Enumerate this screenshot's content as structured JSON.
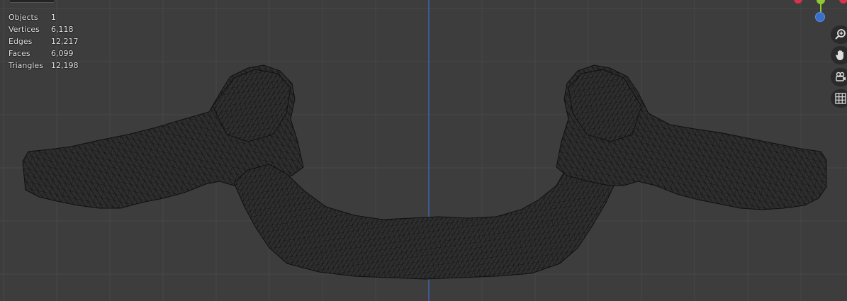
{
  "stats": [
    {
      "label": "Objects",
      "value": "1"
    },
    {
      "label": "Vertices",
      "value": "6,118"
    },
    {
      "label": "Edges",
      "value": "12,217"
    },
    {
      "label": "Faces",
      "value": "6,099"
    },
    {
      "label": "Triangles",
      "value": "12,198"
    }
  ],
  "navigation": {
    "buttons": [
      {
        "name": "zoom",
        "icon": "zoom-icon"
      },
      {
        "name": "pan",
        "icon": "hand-icon"
      },
      {
        "name": "camera-view",
        "icon": "camera-icon"
      },
      {
        "name": "toggle-ortho",
        "icon": "grid-icon"
      }
    ]
  },
  "colors": {
    "background": "#3d3d3d",
    "grid_line": "#484848",
    "axis_y": "#3b6ec9",
    "mesh_fill": "#2e2e2e",
    "mesh_wire": "#111111",
    "gizmo_x": "#d6324c",
    "gizmo_y": "#8fc832",
    "gizmo_z": "#3b6ec9"
  }
}
